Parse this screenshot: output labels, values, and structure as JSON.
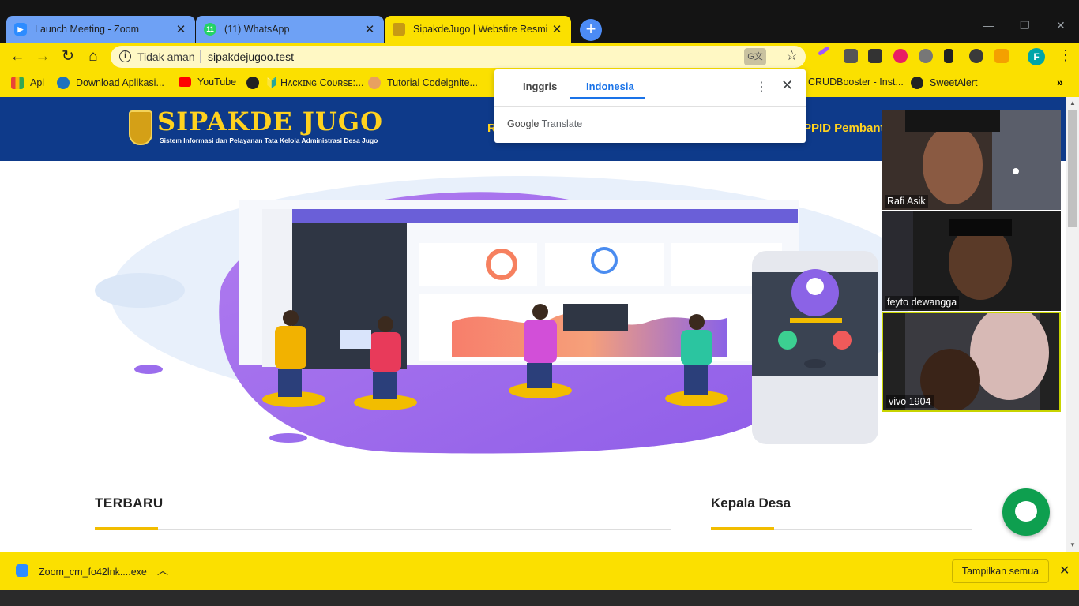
{
  "tabs": [
    {
      "title": "Launch Meeting - Zoom",
      "icon": "zoom-icon",
      "state": "inactive"
    },
    {
      "title": "(11) WhatsApp",
      "icon": "whatsapp-icon",
      "badge": "11",
      "state": "inactive"
    },
    {
      "title": "SipakdeJugo | Webstire Resmi De",
      "icon": "site-emblem-icon",
      "state": "active"
    }
  ],
  "address_bar": {
    "security_text": "Tidak aman",
    "url": "sipakdejugoo.test"
  },
  "bookmarks": [
    {
      "label": "Apl",
      "icon": "apps-grid-icon"
    },
    {
      "label": "Download Aplikasi...",
      "icon": "s-logo-icon"
    },
    {
      "label": "YouTube",
      "icon": "youtube-icon"
    },
    {
      "label": "🔰 Hᴀᴄᴋɪɴɢ Cᴏᴜʀsᴇ:...",
      "icon": "globe-icon"
    },
    {
      "label": "Tutorial Codeignite...",
      "icon": "codeigniter-icon"
    },
    {
      "label": "CRUDBooster - Inst...",
      "icon": "page-icon"
    },
    {
      "label": "SweetAlert",
      "icon": "globe-icon"
    }
  ],
  "profile_initial": "F",
  "translate_popup": {
    "tab_source": "Inggris",
    "tab_target": "Indonesia",
    "brand_google": "Google",
    "brand_translate": "Translate"
  },
  "site": {
    "title": "SIPAKDE JUGO",
    "tagline": "Sistem Informasi dan Pelayanan Tata Kelola Administrasi Desa Jugo",
    "nav_partial_left": "R",
    "nav_partial_right": "PPID Pembantu"
  },
  "sections": {
    "latest": "TERBARU",
    "village_head": "Kepala Desa"
  },
  "zoom_participants": [
    {
      "name": "Rafi Asik"
    },
    {
      "name": "feyto dewangga"
    },
    {
      "name": "vivo 1904"
    }
  ],
  "download_bar": {
    "filename": "Zoom_cm_fo42lnk....exe",
    "show_all": "Tampilkan semua"
  },
  "colors": {
    "chrome_theme": "#fbe000",
    "site_header": "#0e3a8a",
    "site_title": "#ffd21f",
    "accent_underline": "#f2bd00",
    "chat_button": "#0e9f4f",
    "translate_active": "#1a73e8"
  }
}
